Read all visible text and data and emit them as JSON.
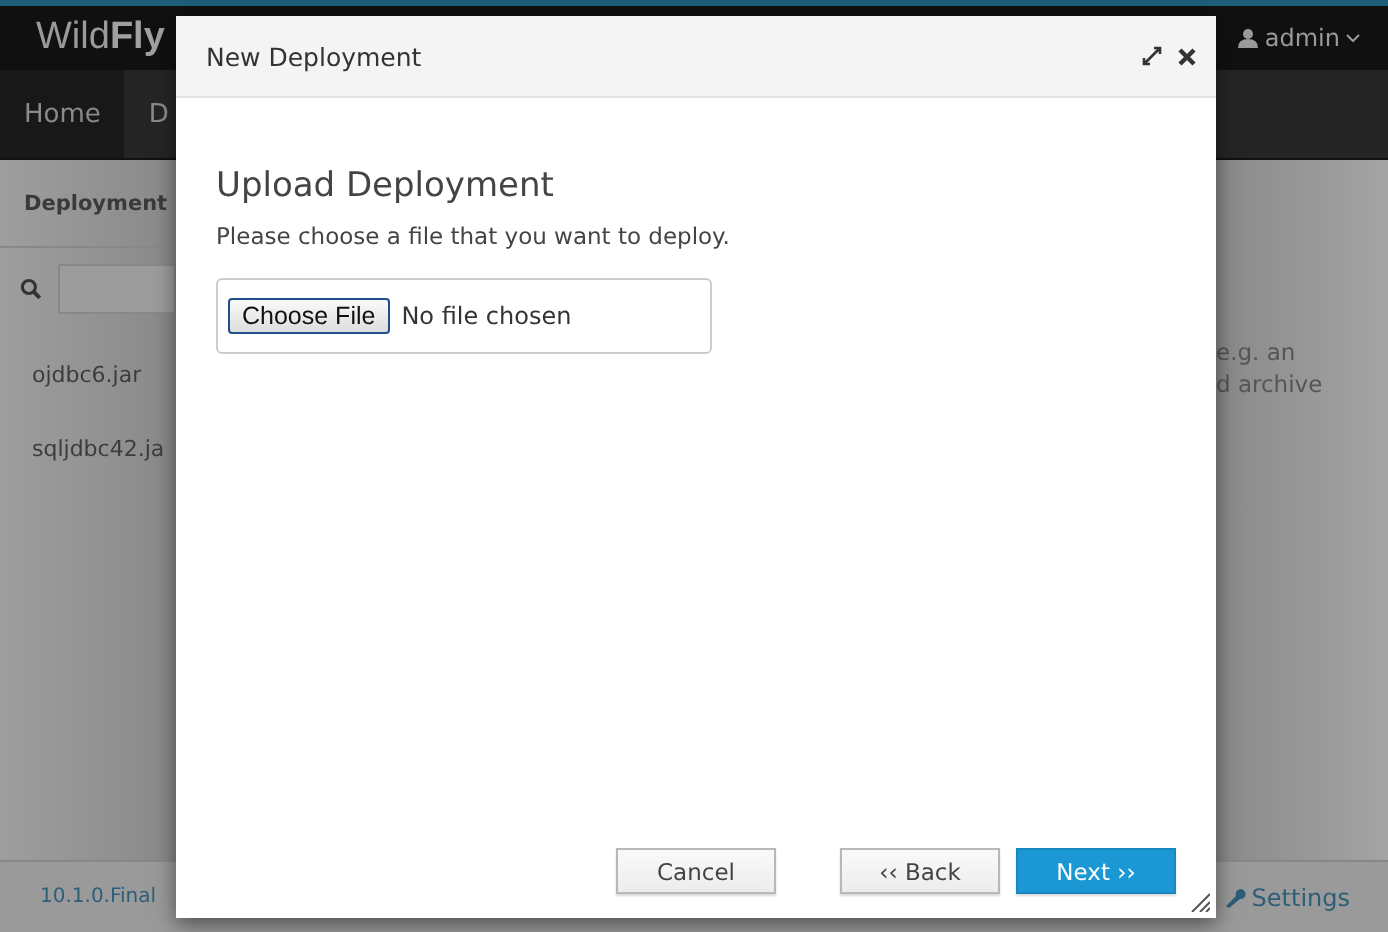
{
  "header": {
    "logo_light": "Wild",
    "logo_bold": "Fly",
    "user": "admin"
  },
  "nav": {
    "items": [
      {
        "label": "Home",
        "selected": true
      },
      {
        "label": "D",
        "selected": false
      }
    ]
  },
  "sidebar": {
    "title": "Deployment",
    "items": [
      "ojdbc6.jar",
      "sqljdbc42.ja"
    ]
  },
  "side_note": [
    "e.g. an",
    "d archive"
  ],
  "footer": {
    "version": "10.1.0.Final",
    "settings": "Settings"
  },
  "dialog": {
    "title": "New Deployment",
    "heading": "Upload Deployment",
    "description": "Please choose a file that you want to deploy.",
    "file_button": "Choose File",
    "file_status": "No file chosen",
    "buttons": [
      {
        "label": "Cancel",
        "kind": "default"
      },
      {
        "label": "‹‹ Back",
        "kind": "default"
      },
      {
        "label": "Next ››",
        "kind": "primary"
      }
    ]
  }
}
